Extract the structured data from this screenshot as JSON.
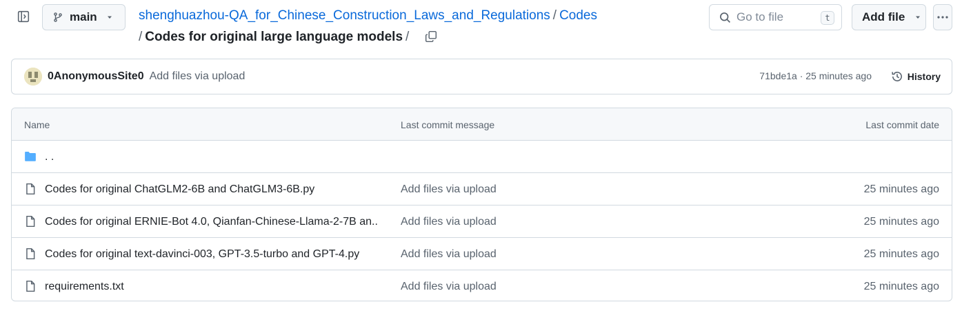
{
  "header": {
    "branch": "main",
    "repo_link": "shenghuazhou-QA_for_Chinese_Construction_Laws_and_Regulations",
    "path_link": "Codes",
    "separator": "/",
    "current_folder": "Codes for original large language models",
    "search_placeholder": "Go to file",
    "search_shortcut": "t",
    "add_file_label": "Add file"
  },
  "commit": {
    "author": "0AnonymousSite0",
    "message": "Add files via upload",
    "sha": "71bde1a",
    "dot": "·",
    "time": "25 minutes ago",
    "history_label": "History"
  },
  "table": {
    "headers": {
      "name": "Name",
      "message": "Last commit message",
      "date": "Last commit date"
    },
    "parent_label": ". .",
    "rows": [
      {
        "name": "Codes for original ChatGLM2-6B and ChatGLM3-6B.py",
        "message": "Add files via upload",
        "date": "25 minutes ago"
      },
      {
        "name": "Codes for original ERNIE-Bot 4.0, Qianfan-Chinese-Llama-2-7B an...",
        "message": "Add files via upload",
        "date": "25 minutes ago"
      },
      {
        "name": "Codes for original text-davinci-003, GPT-3.5-turbo and GPT-4.py",
        "message": "Add files via upload",
        "date": "25 minutes ago"
      },
      {
        "name": "requirements.txt",
        "message": "Add files via upload",
        "date": "25 minutes ago"
      }
    ]
  },
  "icons": {
    "sidebar": "sidebar-expand-icon",
    "branch": "git-branch-icon",
    "copy": "copy-icon",
    "search": "search-icon",
    "more": "kebab-horizontal-icon",
    "history": "history-icon",
    "folder": "folder-icon",
    "file": "file-icon"
  },
  "colors": {
    "link": "#0969da",
    "folder": "#54aeff",
    "muted": "#59636e",
    "border": "#d1d9e0"
  }
}
